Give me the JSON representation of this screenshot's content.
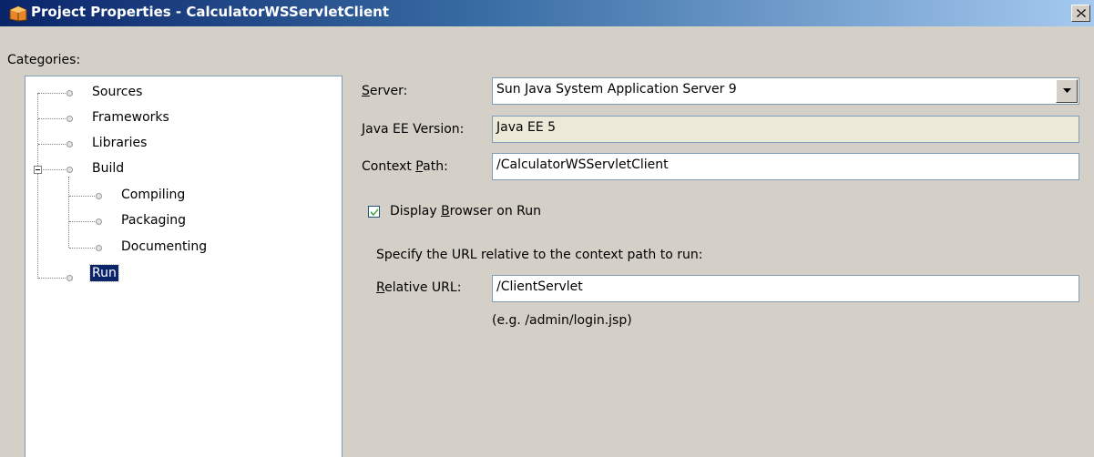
{
  "window": {
    "title": "Project Properties - CalculatorWSServletClient"
  },
  "categories": {
    "label": "Categories:",
    "items": [
      {
        "label": "Sources"
      },
      {
        "label": "Frameworks"
      },
      {
        "label": "Libraries"
      },
      {
        "label": "Build",
        "children": [
          {
            "label": "Compiling"
          },
          {
            "label": "Packaging"
          },
          {
            "label": "Documenting"
          }
        ]
      },
      {
        "label": "Run",
        "selected": true
      }
    ]
  },
  "run_panel": {
    "server_label": "Server:",
    "server_value": "Sun Java System Application Server 9",
    "javaee_label": "Java EE Version:",
    "javaee_value": "Java EE 5",
    "context_label": "Context Path:",
    "context_value": "/CalculatorWSServletClient",
    "display_browser_label": "Display Browser on Run",
    "display_browser_checked": true,
    "relative_hint": "Specify the URL relative to the context path to run:",
    "relative_label": "Relative URL:",
    "relative_value": "/ClientServlet",
    "relative_example": "(e.g. /admin/login.jsp)"
  },
  "colors": {
    "title_gradient_start": "#0a246a",
    "title_gradient_end": "#a6caf0",
    "selection": "#0a246a",
    "dialog_bg": "#d4d0c8"
  },
  "icons": [
    "netbeans-project-icon",
    "close-icon",
    "tree-node-icon",
    "collapse-icon",
    "dropdown-arrow-icon",
    "checkmark-icon"
  ]
}
